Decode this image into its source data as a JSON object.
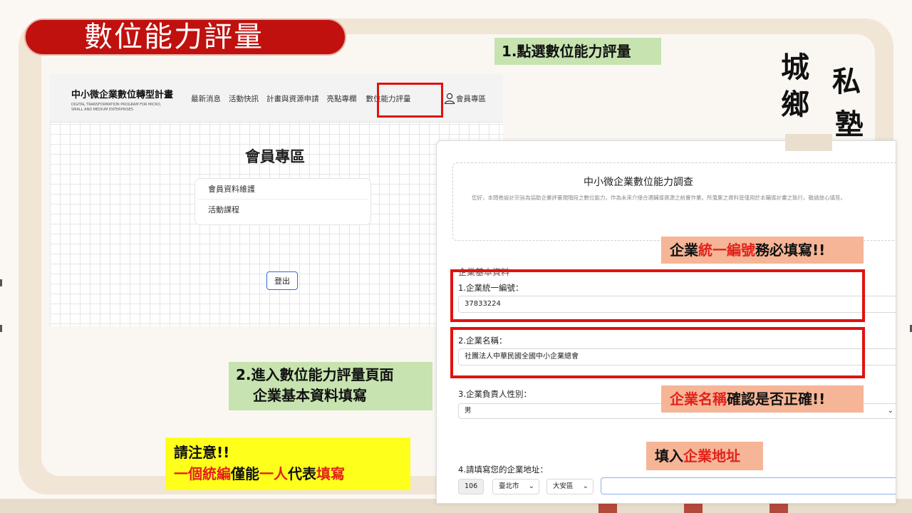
{
  "slide": {
    "title": "數位能力評量",
    "callouts": {
      "step1": "1.點選數位能力評量",
      "step2_line1": "2.進入數位能力評量頁面",
      "step2_line2": "企業基本資料填寫",
      "note_line1": "請注意!!",
      "note_line2": {
        "p1": "一個統編",
        "p2": "僅能",
        "p3": "一人",
        "p4": "代表",
        "p5": "填寫"
      },
      "uid": {
        "p1": "企業",
        "p2": "統一編號",
        "p3": "務必填寫!!"
      },
      "name": {
        "p1": "企業名稱",
        "p2": "確認是否正確!!"
      },
      "addr": {
        "p1": "填入",
        "p2": "企業地址"
      }
    },
    "calligraphy": [
      "城",
      "鄉",
      "私",
      "塾"
    ]
  },
  "site": {
    "brand_title": "中小微企業數位轉型計畫",
    "brand_sub1": "DIGITAL TRANSFORMATION PROGRAM FOR MICRO,",
    "brand_sub2": "SMALL AND MEDIUM ENTERPRISES",
    "nav": [
      "最新消息",
      "活動快訊",
      "計畫與資源申請",
      "亮點專欄",
      "數位能力評量"
    ],
    "member_link": "會員專區",
    "page_title": "會員專區",
    "menu": [
      "會員資料維護",
      "活動課程"
    ],
    "logout": "登出"
  },
  "survey": {
    "title": "中小微企業數位能力調查",
    "desc": "您好，本問卷設計宗旨為協助企業評量現階段之數位能力，作為未來介接合適輔導資源之前置作業。所蒐集之資料皆僅用於本輔導計畫之執行，敬請放心填答。",
    "section": "企業基本資料",
    "q1_label": "1.企業統一編號：",
    "q1_value": "37833224",
    "q2_label": "2.企業名稱：",
    "q2_value": "社團法人中華民國全國中小企業總會",
    "q3_label": "3.企業負責人性別：",
    "q3_value": "男",
    "q4_label": "4.請填寫您的企業地址：",
    "q4_zip": "106",
    "q4_city": "臺北市",
    "q4_district": "大安區",
    "q4_address": ""
  }
}
